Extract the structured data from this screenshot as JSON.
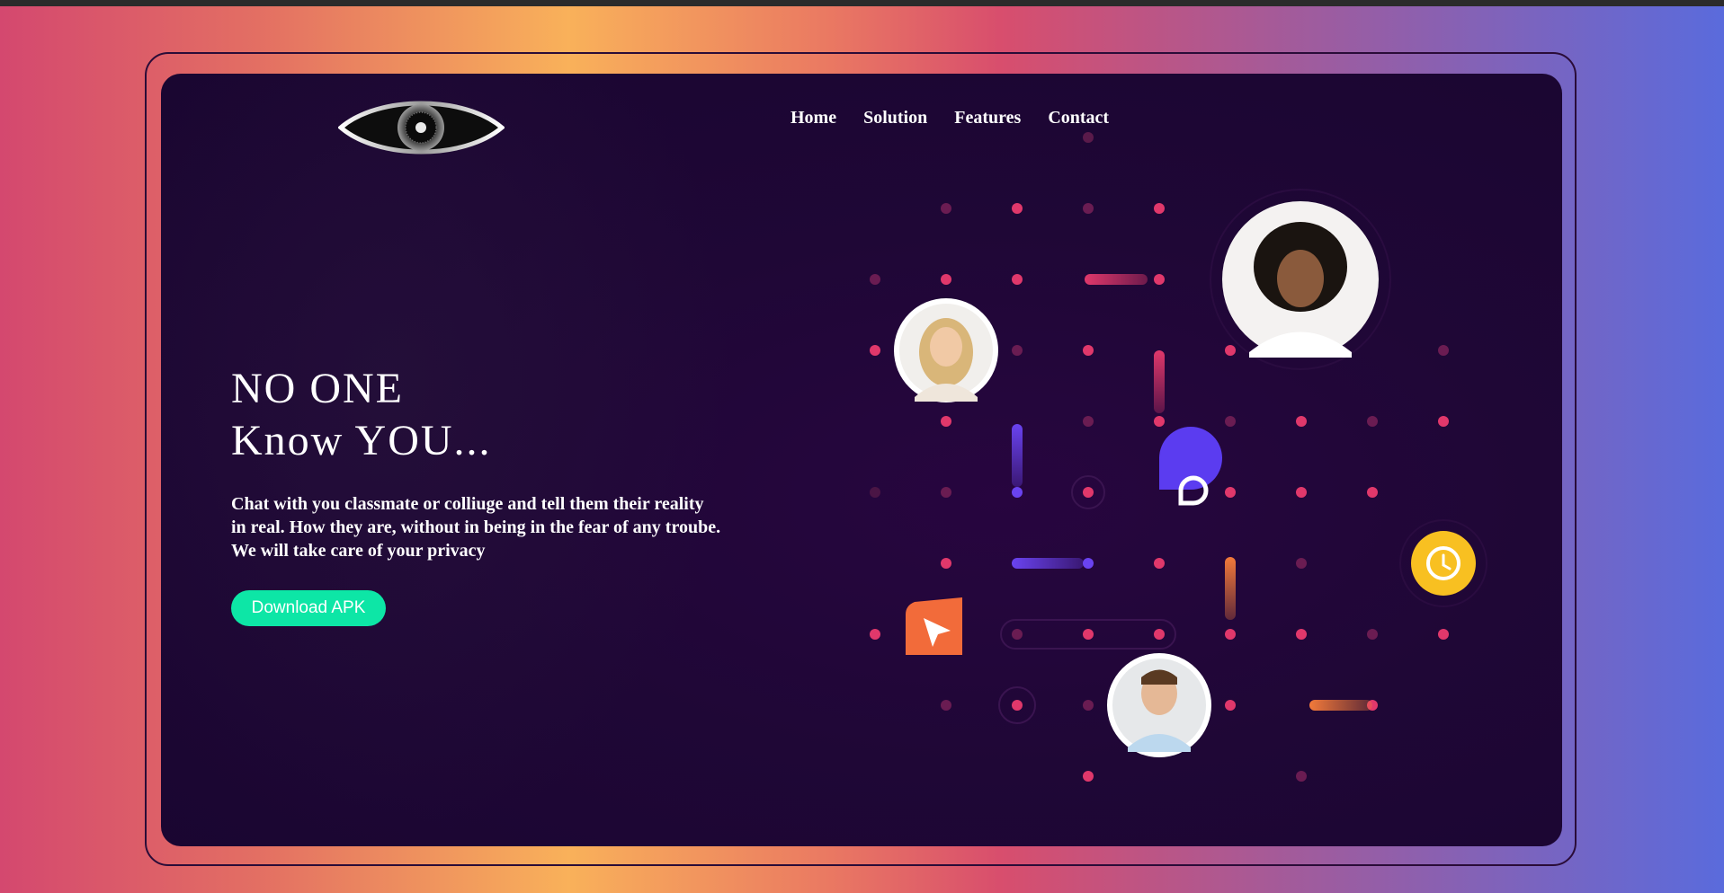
{
  "nav": {
    "items": [
      {
        "label": "Home"
      },
      {
        "label": "Solution"
      },
      {
        "label": "Features"
      },
      {
        "label": "Contact"
      }
    ]
  },
  "hero": {
    "title_line1": "NO ONE",
    "title_line2": "Know YOU...",
    "description": "Chat with you classmate or colliuge and tell them their reality in real. How they are, without in being in the fear of any troube. We will take care of your privacy",
    "cta_label": "Download APK"
  },
  "colors": {
    "cta": "#0de6a6",
    "card_bg": "#1f0736",
    "dot_pink": "#e0386b",
    "chat_icon_bg": "#5b3cf0",
    "clock_icon_bg": "#f8c021",
    "send_icon_bg": "#f26b3a"
  },
  "icons": {
    "logo": "eye-logo",
    "chat": "chat-bubble-icon",
    "clock": "clock-icon",
    "send": "send-arrow-icon"
  }
}
